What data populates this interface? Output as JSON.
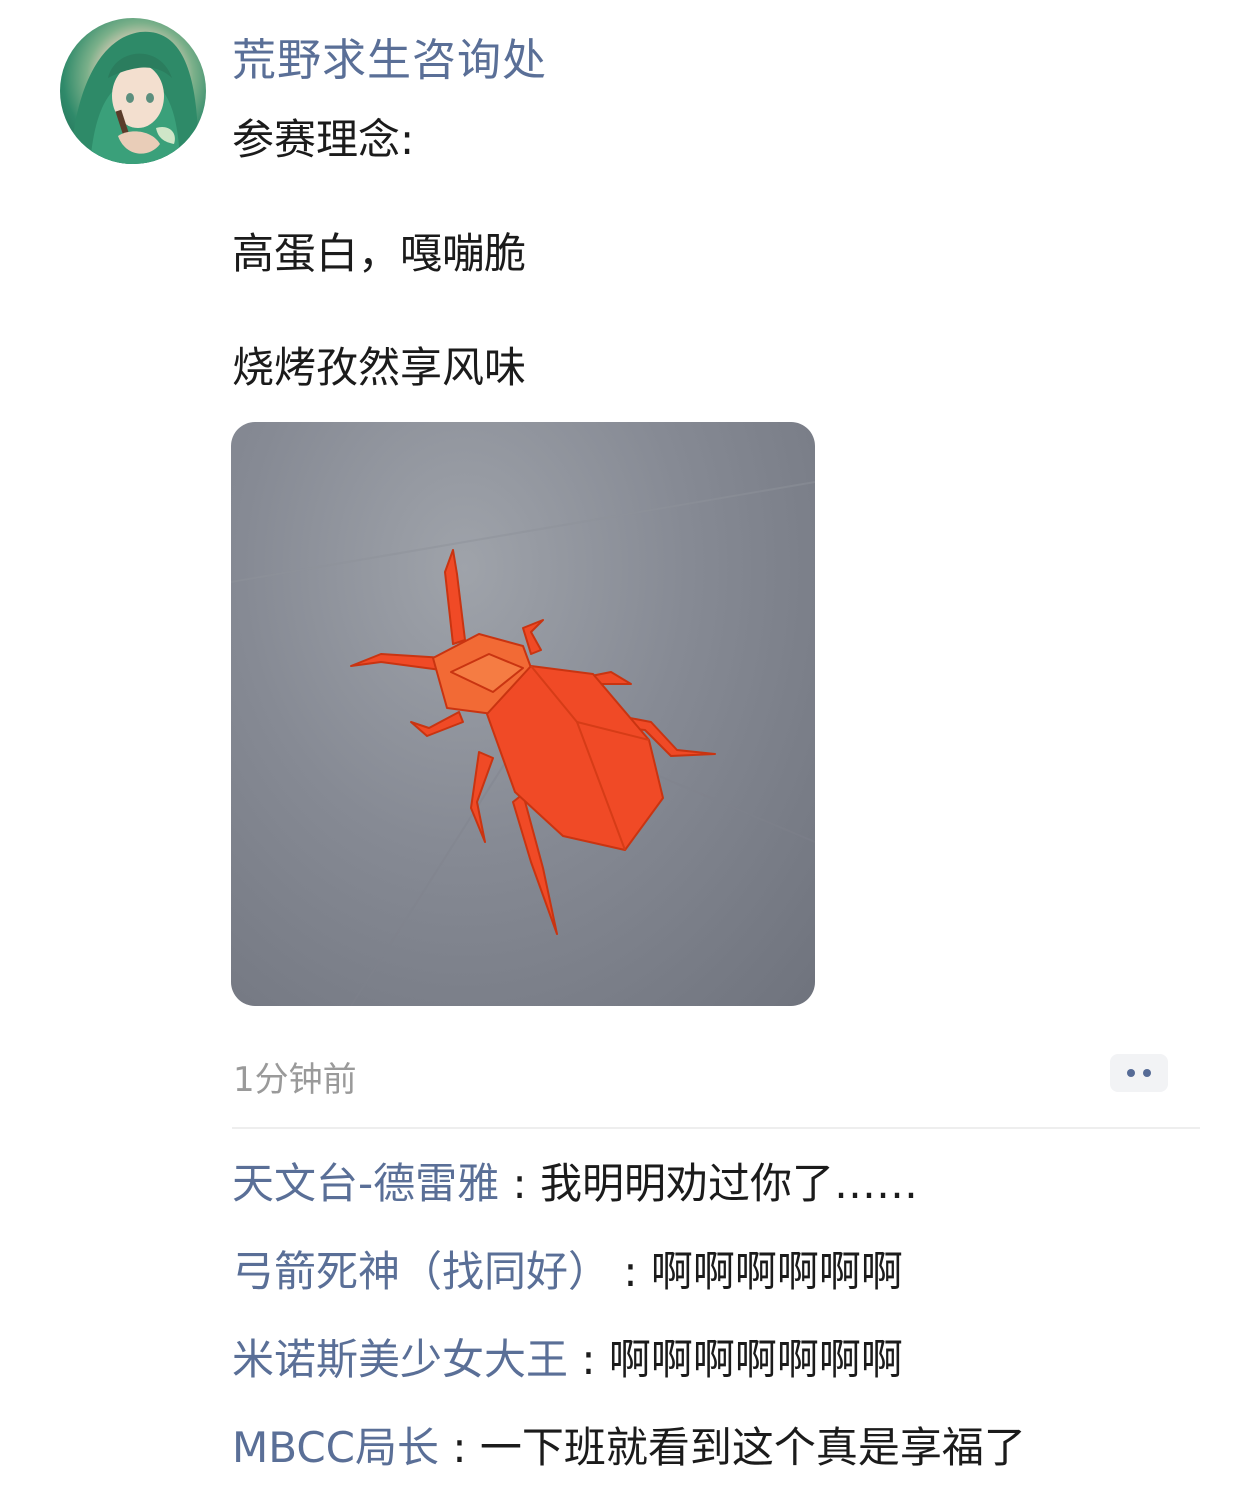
{
  "post": {
    "author": "荒野求生咨询处",
    "lines": [
      "参赛理念:",
      "高蛋白，嘎嘣脆",
      "烧烤孜然享风味"
    ],
    "timestamp": "1分钟前"
  },
  "comments": [
    {
      "name": "天文台-德雷雅",
      "separator": ":",
      "text": "我明明劝过你了……"
    },
    {
      "name": "弓箭死神（找同好）",
      "separator": ":",
      "text": "啊啊啊啊啊啊"
    },
    {
      "name": "米诺斯美少女大王",
      "separator": ":",
      "text": "啊啊啊啊啊啊啊"
    },
    {
      "name": "MBCC局长",
      "separator": ":",
      "text": "一下班就看到这个真是享福了"
    }
  ],
  "icons": {
    "more": "more-dots-icon"
  },
  "colors": {
    "name_link": "#5a6f97",
    "text": "#1b1b1b",
    "timestamp": "#9a9a9a",
    "insect": "#f0502a"
  }
}
